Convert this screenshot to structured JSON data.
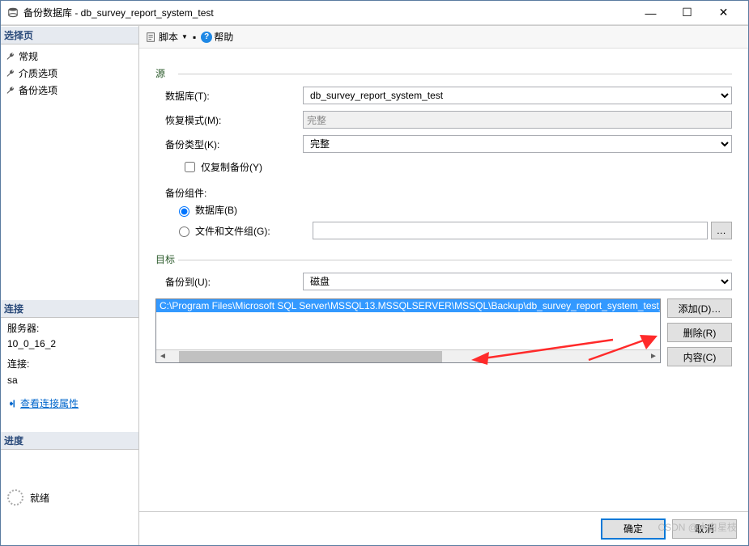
{
  "window": {
    "title": "备份数据库 - db_survey_report_system_test"
  },
  "winControls": {
    "min": "—",
    "max": "☐",
    "close": "✕"
  },
  "left": {
    "selectHeader": "选择页",
    "pages": [
      "常规",
      "介质选项",
      "备份选项"
    ],
    "connectHeader": "连接",
    "serverLabel": "服务器:",
    "serverValue": "10_0_16_2",
    "connLabel": "连接:",
    "connValue": "sa",
    "viewConnLink": "查看连接属性",
    "progressHeader": "进度",
    "progressStatus": "就绪"
  },
  "toolbar": {
    "script": "脚本",
    "dropdown": "▼",
    "help": "帮助"
  },
  "form": {
    "source": {
      "title": "源",
      "dbLabel": "数据库(T):",
      "dbValue": "db_survey_report_system_test",
      "recoveryLabel": "恢复模式(M):",
      "recoveryValue": "完整",
      "typeLabel": "备份类型(K):",
      "typeValue": "完整",
      "copyOnly": "仅复制备份(Y)",
      "componentTitle": "备份组件:",
      "radioDb": "数据库(B)",
      "radioFile": "文件和文件组(G):"
    },
    "dest": {
      "title": "目标",
      "toLabel": "备份到(U):",
      "toValue": "磁盘",
      "path": "C:\\Program Files\\Microsoft SQL Server\\MSSQL13.MSSQLSERVER\\MSSQL\\Backup\\db_survey_report_system_test_Lo",
      "addBtn": "添加(D)…",
      "removeBtn": "删除(R)",
      "contentBtn": "内容(C)"
    }
  },
  "footer": {
    "ok": "确定",
    "cancel": "取消"
  },
  "watermark": "CSDN @木白星枝"
}
